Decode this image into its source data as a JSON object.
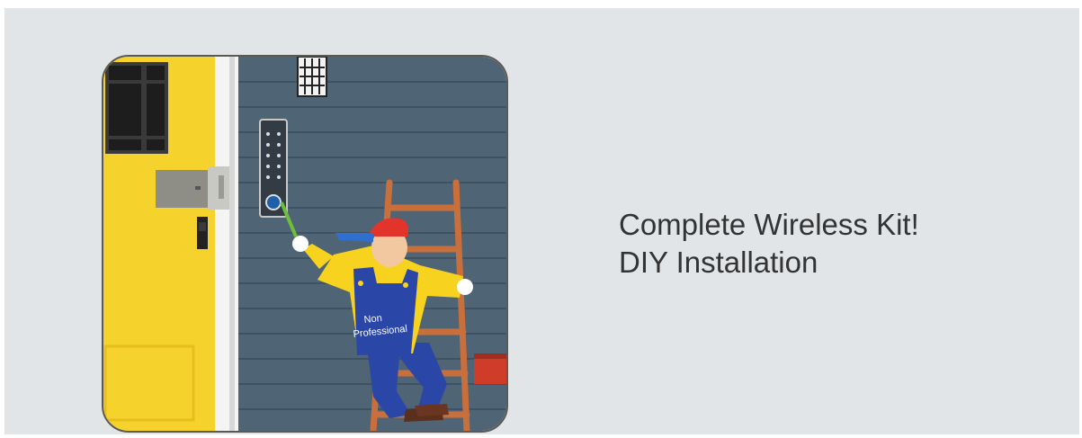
{
  "headline": {
    "line1": "Complete Wireless Kit!",
    "line2": "DIY Installation"
  },
  "illustration": {
    "overalls_text_line1": "Non",
    "overalls_text_line2": "Professional"
  },
  "colors": {
    "background": "#e1e5e8",
    "door": "#f6d22c",
    "wall": "#4f6474",
    "ladder": "#c96f3b",
    "shirt": "#f7d21f",
    "overalls": "#2a47a8",
    "cap": "#e3342c",
    "text": "#333333"
  }
}
